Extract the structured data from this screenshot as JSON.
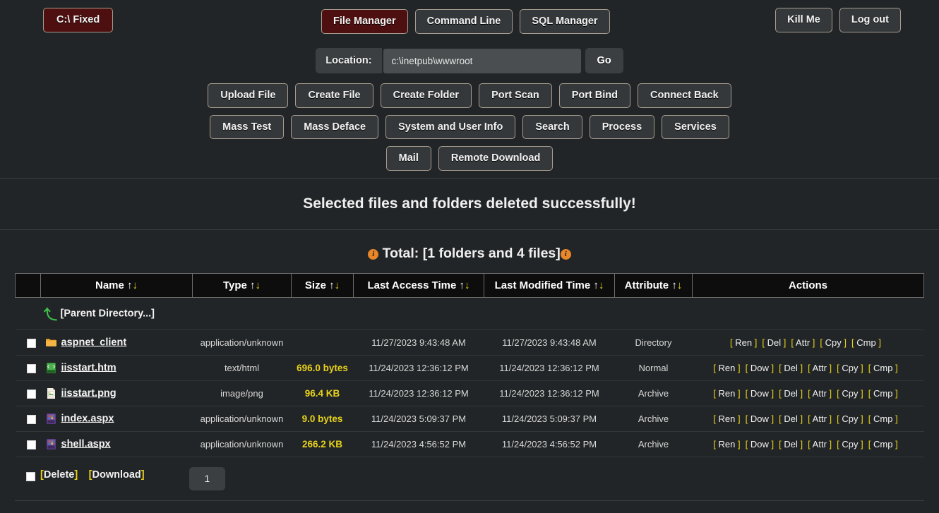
{
  "topbar": {
    "drive_button": "C:\\ Fixed",
    "modes": [
      {
        "label": "File Manager",
        "active": true
      },
      {
        "label": "Command Line",
        "active": false
      },
      {
        "label": "SQL Manager",
        "active": false
      }
    ],
    "session": [
      {
        "label": "Kill Me"
      },
      {
        "label": "Log out"
      }
    ]
  },
  "location": {
    "label": "Location:",
    "value": "c:\\inetpub\\wwwroot",
    "placeholder": "c:\\inetpub\\wwwroot",
    "go_label": "Go"
  },
  "actions": {
    "row1": [
      "Upload File",
      "Create File",
      "Create Folder",
      "Port Scan",
      "Port Bind",
      "Connect Back"
    ],
    "row2": [
      "Mass Test",
      "Mass Deface",
      "System and User Info",
      "Search",
      "Process",
      "Services"
    ],
    "row3": [
      "Mail",
      "Remote Download"
    ]
  },
  "status_message": "Selected files and folders deleted successfully!",
  "total": {
    "prefix_icon": "info-icon",
    "text": "Total: [1 folders and 4 files]",
    "suffix_icon": "info-icon"
  },
  "table": {
    "columns": [
      {
        "label": "Name",
        "sortable": true
      },
      {
        "label": "Type",
        "sortable": true
      },
      {
        "label": "Size",
        "sortable": true
      },
      {
        "label": "Last Access Time",
        "sortable": true
      },
      {
        "label": "Last Modified Time",
        "sortable": true
      },
      {
        "label": "Attribute",
        "sortable": true
      },
      {
        "label": "Actions",
        "sortable": false
      }
    ],
    "sort_up_glyph": "↑",
    "sort_down_glyph": "↓",
    "parent_row": {
      "icon": "back-arrow-icon",
      "label": "[Parent Directory...]"
    },
    "rows": [
      {
        "checked": false,
        "icon": "folder-icon",
        "name": "aspnet_client",
        "type": "application/unknown",
        "size": "",
        "last_access": "11/27/2023 9:43:48 AM",
        "last_modified": "11/27/2023 9:43:48 AM",
        "attribute": "Directory",
        "actions": [
          "Ren",
          "Del",
          "Attr",
          "Cpy",
          "Cmp"
        ]
      },
      {
        "checked": false,
        "icon": "html-file-icon",
        "name": "iisstart.htm",
        "type": "text/html",
        "size": "696.0 bytes",
        "last_access": "11/24/2023 12:36:12 PM",
        "last_modified": "11/24/2023 12:36:12 PM",
        "attribute": "Normal",
        "actions": [
          "Ren",
          "Dow",
          "Del",
          "Attr",
          "Cpy",
          "Cmp"
        ]
      },
      {
        "checked": false,
        "icon": "image-file-icon",
        "name": "iisstart.png",
        "type": "image/png",
        "size": "96.4 KB",
        "last_access": "11/24/2023 12:36:12 PM",
        "last_modified": "11/24/2023 12:36:12 PM",
        "attribute": "Archive",
        "actions": [
          "Ren",
          "Dow",
          "Del",
          "Attr",
          "Cpy",
          "Cmp"
        ]
      },
      {
        "checked": false,
        "icon": "aspx-file-icon",
        "name": "index.aspx",
        "type": "application/unknown",
        "size": "9.0 bytes",
        "last_access": "11/24/2023 5:09:37 PM",
        "last_modified": "11/24/2023 5:09:37 PM",
        "attribute": "Archive",
        "actions": [
          "Ren",
          "Dow",
          "Del",
          "Attr",
          "Cpy",
          "Cmp"
        ]
      },
      {
        "checked": false,
        "icon": "aspx-file-icon",
        "name": "shell.aspx",
        "type": "application/unknown",
        "size": "266.2 KB",
        "last_access": "11/24/2023 4:56:52 PM",
        "last_modified": "11/24/2023 4:56:52 PM",
        "attribute": "Archive",
        "actions": [
          "Ren",
          "Dow",
          "Del",
          "Attr",
          "Cpy",
          "Cmp"
        ]
      }
    ]
  },
  "bottom": {
    "select_all_checked": false,
    "delete_label": "Delete",
    "download_label": "Download",
    "page_number": "1"
  },
  "colors": {
    "page_bg": "#222527",
    "accent_red": "#4d0f0f",
    "button_bg": "#3b3f41",
    "button_border": "#a79d8f",
    "size_yellow": "#e8d21a",
    "info_orange": "#e8862a",
    "folder_orange": "#f0a52c",
    "parent_green": "#3ec24a"
  }
}
